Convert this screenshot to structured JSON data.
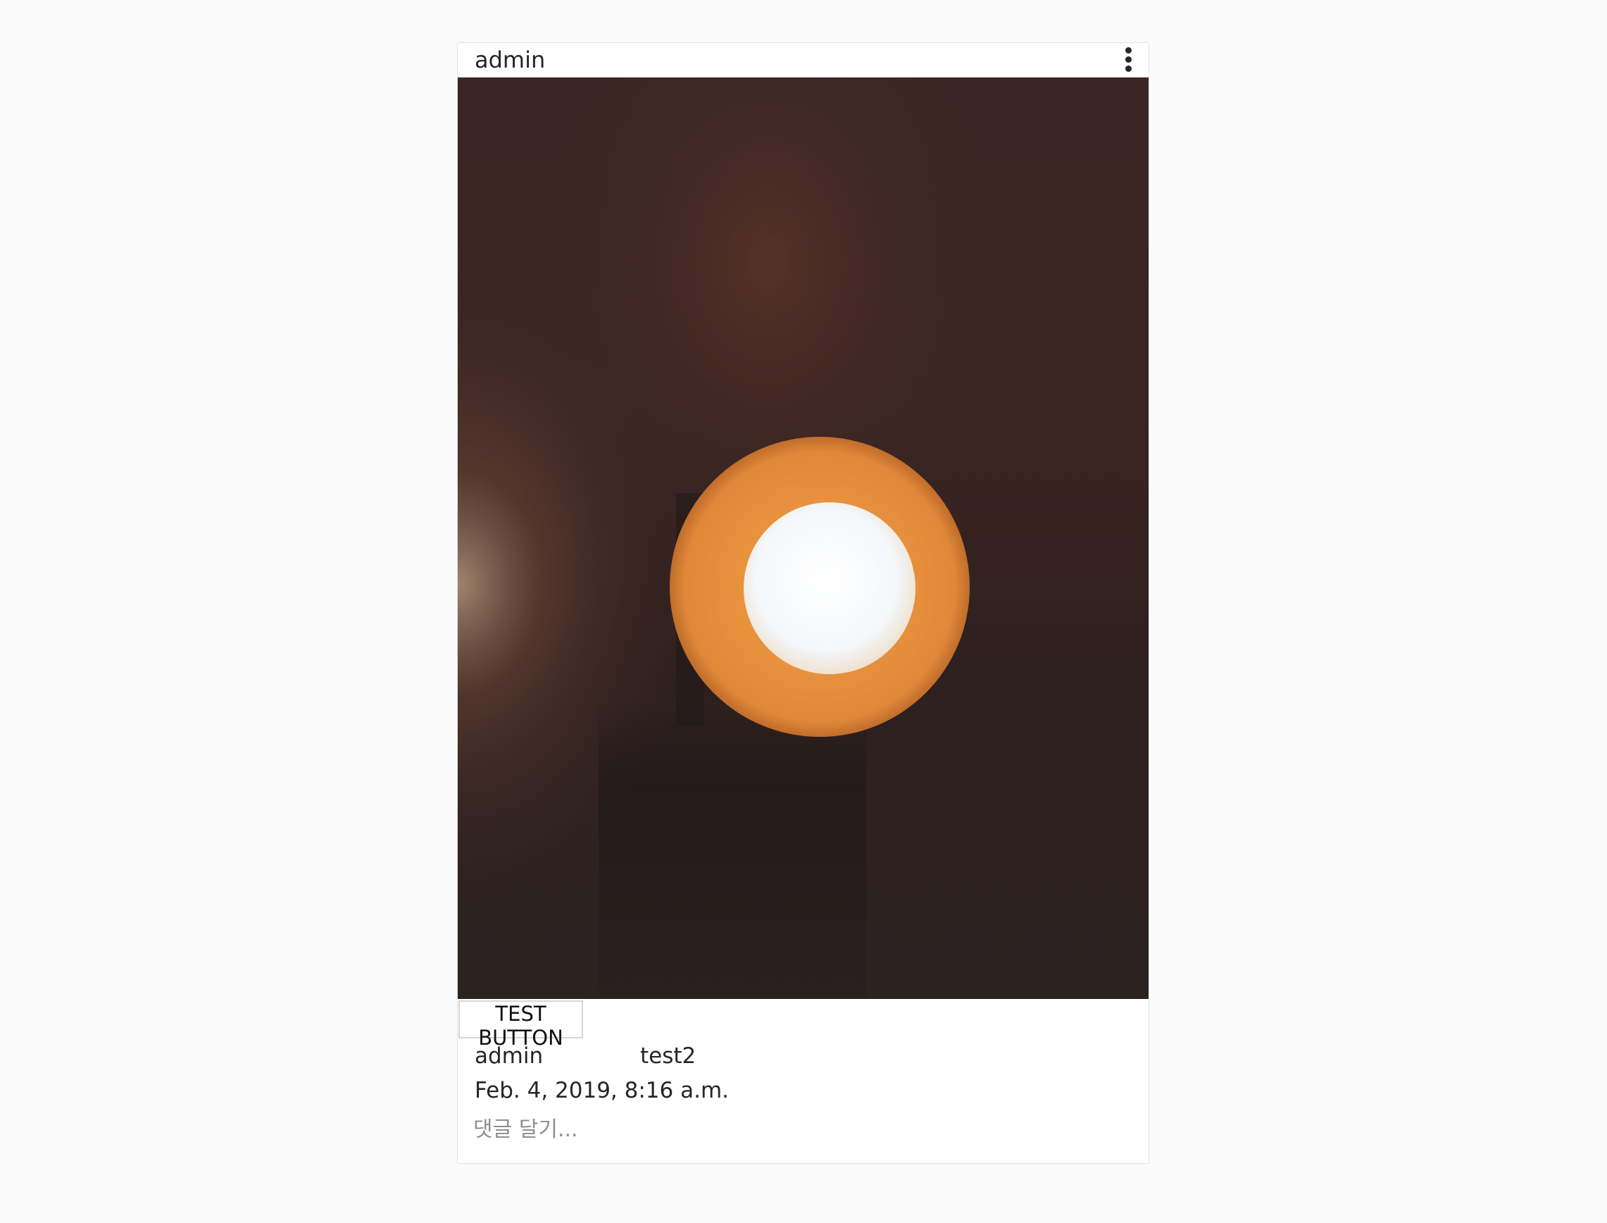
{
  "post": {
    "username": "admin",
    "more_icon": "vertical-ellipsis-icon",
    "photo_description_icon": "latte-photo",
    "test_button_label": "TEST BUTTON",
    "comments": [
      {
        "author": "admin",
        "text": "test2"
      }
    ],
    "timestamp": "Feb. 4, 2019, 8:16 a.m.",
    "comment_placeholder": "댓글 달기..."
  },
  "colors": {
    "page_background": "#fafafa",
    "card_background": "#ffffff",
    "card_border": "#e2e2e2",
    "text": "#262626",
    "placeholder": "#8e8e8e"
  }
}
